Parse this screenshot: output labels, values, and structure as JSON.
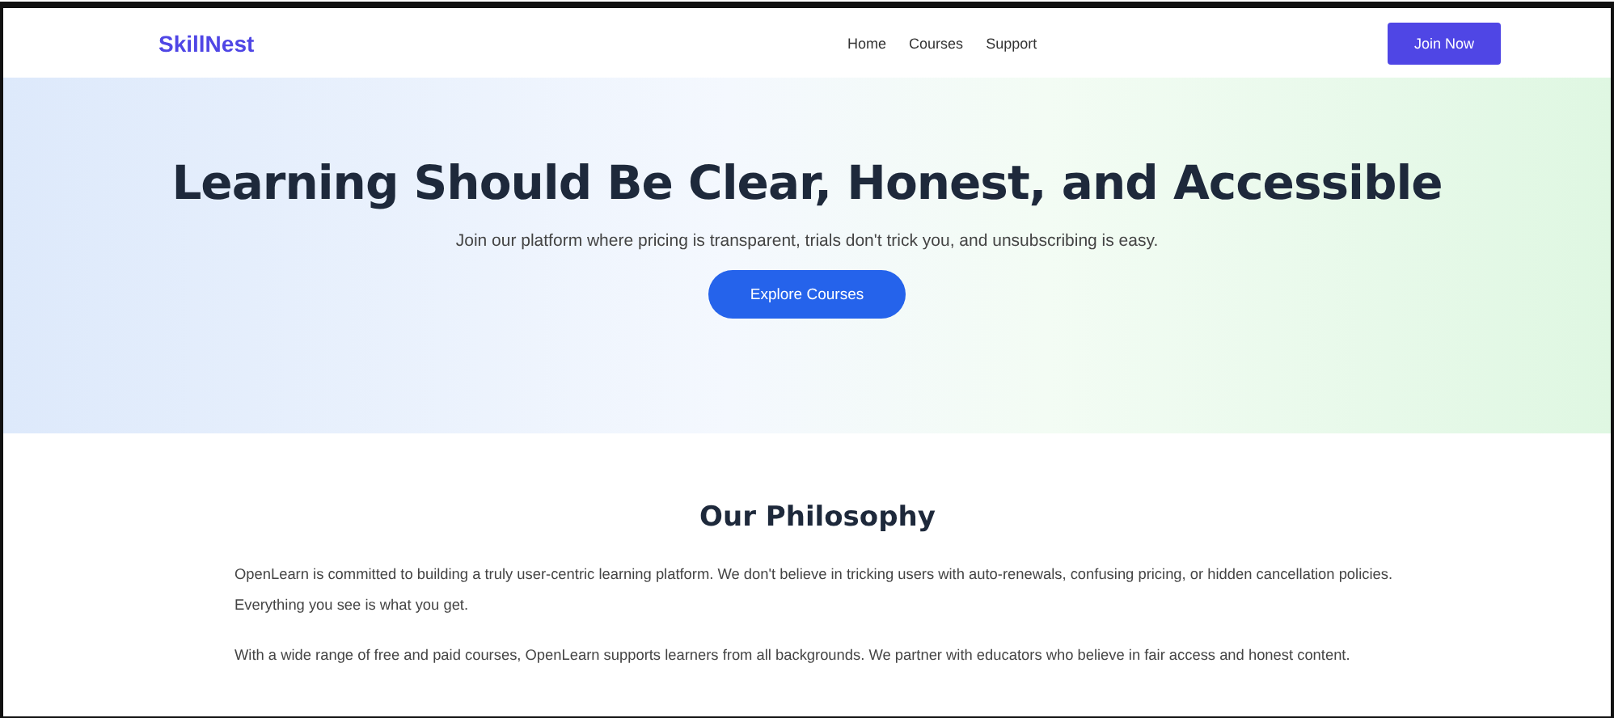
{
  "navbar": {
    "logo": "SkillNest",
    "links": [
      {
        "label": "Home"
      },
      {
        "label": "Courses"
      },
      {
        "label": "Support"
      }
    ],
    "cta": "Join Now"
  },
  "hero": {
    "title": "Learning Should Be Clear, Honest, and Accessible",
    "subtitle": "Join our platform where pricing is transparent, trials don't trick you, and unsubscribing is easy.",
    "button": "Explore Courses"
  },
  "philosophy": {
    "heading": "Our Philosophy",
    "paragraphs": [
      "OpenLearn is committed to building a truly user-centric learning platform. We don't believe in tricking users with auto-renewals, confusing pricing, or hidden cancellation policies. Everything you see is what you get.",
      "With a wide range of free and paid courses, OpenLearn supports learners from all backgrounds. We partner with educators who believe in fair access and honest content."
    ]
  }
}
